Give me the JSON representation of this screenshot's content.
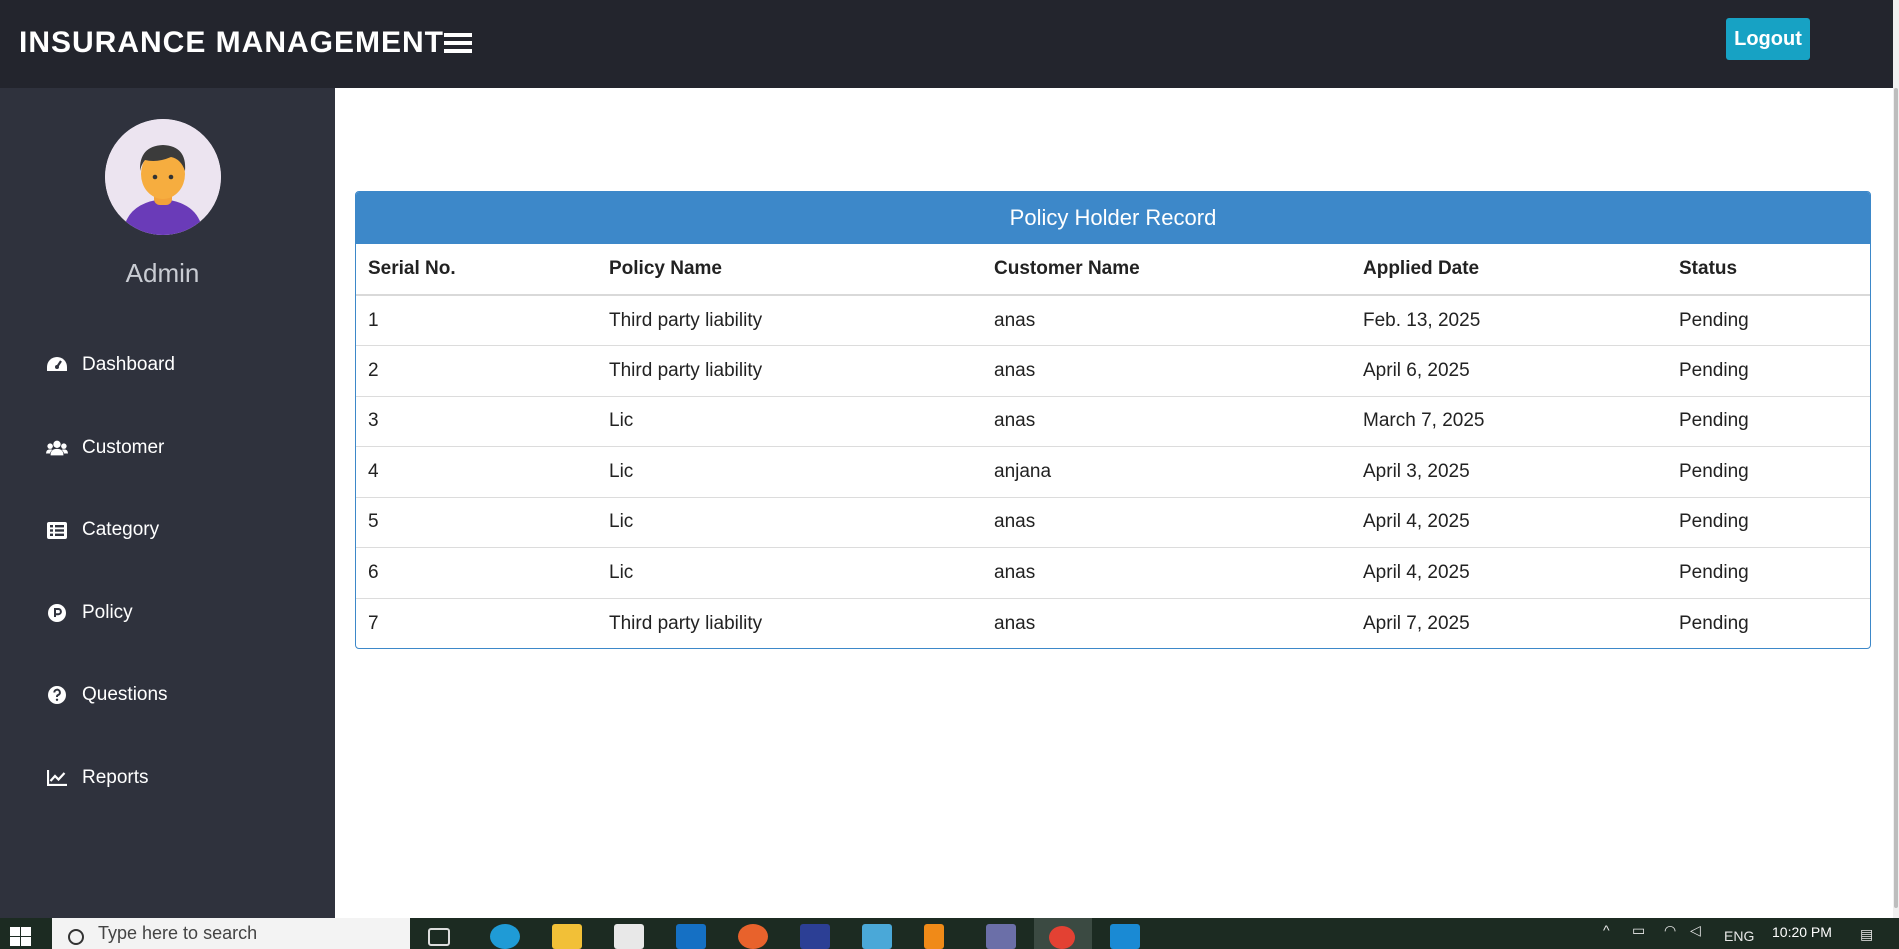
{
  "header": {
    "brand": "INSURANCE MANAGEMENT",
    "logout_label": "Logout"
  },
  "sidebar": {
    "user_name": "Admin",
    "items": [
      {
        "label": "Dashboard",
        "icon": "tachometer-icon"
      },
      {
        "label": "Customer",
        "icon": "users-icon"
      },
      {
        "label": "Category",
        "icon": "list-icon"
      },
      {
        "label": "Policy",
        "icon": "product-hunt-icon"
      },
      {
        "label": "Questions",
        "icon": "question-circle-icon"
      },
      {
        "label": "Reports",
        "icon": "line-chart-icon"
      }
    ]
  },
  "table": {
    "title": "Policy Holder Record",
    "columns": [
      "Serial No.",
      "Policy Name",
      "Customer Name",
      "Applied Date",
      "Status"
    ],
    "rows": [
      [
        "1",
        "Third party liability",
        "anas",
        "Feb. 13, 2025",
        "Pending"
      ],
      [
        "2",
        "Third party liability",
        "anas",
        "April 6, 2025",
        "Pending"
      ],
      [
        "3",
        "Lic",
        "anas",
        "March 7, 2025",
        "Pending"
      ],
      [
        "4",
        "Lic",
        "anjana",
        "April 3, 2025",
        "Pending"
      ],
      [
        "5",
        "Lic",
        "anas",
        "April 4, 2025",
        "Pending"
      ],
      [
        "6",
        "Lic",
        "anas",
        "April 4, 2025",
        "Pending"
      ],
      [
        "7",
        "Third party liability",
        "anas",
        "April 7, 2025",
        "Pending"
      ]
    ]
  },
  "taskbar": {
    "search_placeholder": "Type here to search",
    "language": "ENG",
    "time": "10:20 PM"
  },
  "colors": {
    "header_bg": "#23252d",
    "sidebar_bg": "#2f323d",
    "card_accent": "#3d88c9",
    "logout_bg": "#17a2c4"
  }
}
